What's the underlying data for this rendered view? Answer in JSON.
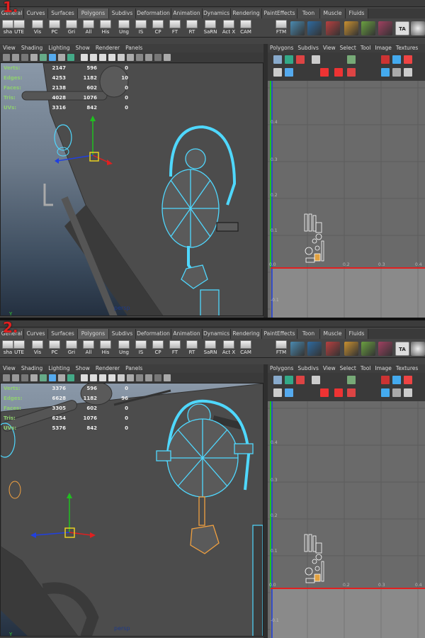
{
  "shelf": {
    "tabs": [
      "General",
      "Curves",
      "Surfaces",
      "Polygons",
      "Subdivs",
      "Deformation",
      "Animation",
      "Dynamics",
      "Rendering",
      "PaintEffects",
      "Toon",
      "Muscle",
      "Fluids"
    ],
    "buttons": [
      "sha",
      "UTE",
      "Vis",
      "PC",
      "Gri",
      "All",
      "His",
      "Ung",
      "IS",
      "CP",
      "FT",
      "RT",
      "SaRN",
      "Act X",
      "CAM",
      "FTM"
    ],
    "last_badge": "TA"
  },
  "viewport": {
    "menus": [
      "View",
      "Shading",
      "Lighting",
      "Show",
      "Renderer",
      "Panels"
    ],
    "camera": "persp",
    "axis_y": "Y",
    "axis_x": "X"
  },
  "uv_editor": {
    "menus": [
      "Polygons",
      "Subdivs",
      "View",
      "Select",
      "Tool",
      "Image",
      "Textures"
    ],
    "ticks_y": [
      "0.4",
      "0.3",
      "0.2",
      "0.1"
    ],
    "ticks_x": [
      "0.0",
      "0.2",
      "0.3",
      "0.4"
    ],
    "tick_neg": "-0.1"
  },
  "panels": [
    {
      "label": "1.",
      "hud": [
        {
          "label": "Verts:",
          "values": [
            "2147",
            "596",
            "0"
          ]
        },
        {
          "label": "Edges:",
          "values": [
            "4253",
            "1182",
            "10"
          ]
        },
        {
          "label": "Faces:",
          "values": [
            "2138",
            "602",
            "0"
          ]
        },
        {
          "label": "Tris:",
          "values": [
            "4028",
            "1076",
            "0"
          ]
        },
        {
          "label": "UVs:",
          "values": [
            "3316",
            "842",
            "0"
          ]
        }
      ]
    },
    {
      "label": "2.",
      "hud": [
        {
          "label": "Verts:",
          "values": [
            "3376",
            "596",
            "0"
          ]
        },
        {
          "label": "Edges:",
          "values": [
            "6628",
            "1182",
            "96"
          ]
        },
        {
          "label": "Faces:",
          "values": [
            "3305",
            "602",
            "0"
          ]
        },
        {
          "label": "Tris:",
          "values": [
            "6254",
            "1076",
            "0"
          ]
        },
        {
          "label": "UVs:",
          "values": [
            "5376",
            "842",
            "0"
          ]
        }
      ]
    }
  ],
  "colors": {
    "wireframe": "#4fd8ff",
    "selected": "#f0a040",
    "axis_x": "#e02020",
    "axis_y": "#20c020",
    "axis_z": "#2040e0",
    "manip_center": "#e8d020"
  }
}
